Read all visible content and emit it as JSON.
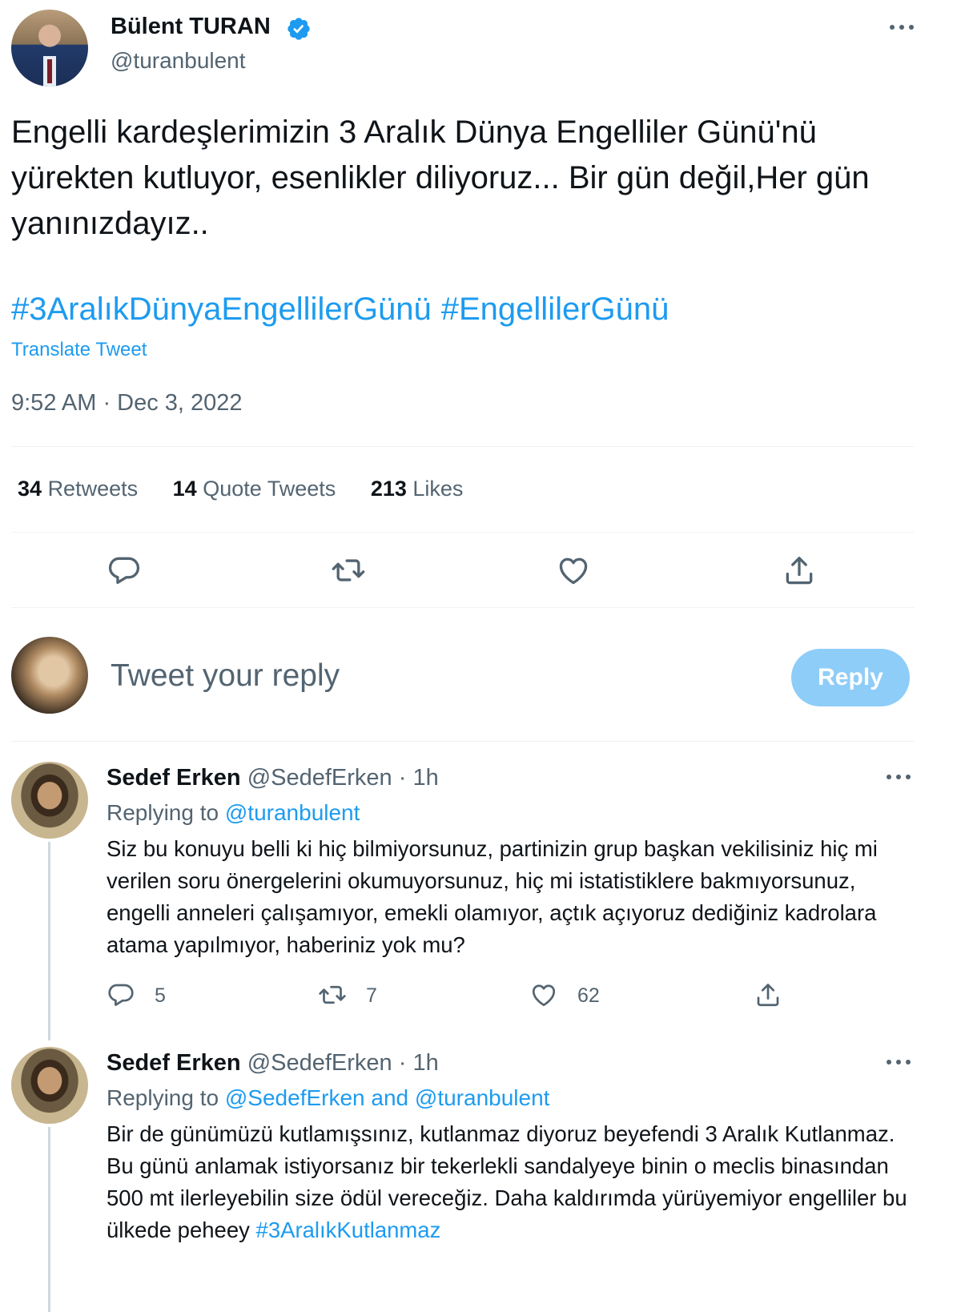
{
  "tweet": {
    "author_name": "Bülent TURAN",
    "author_handle": "@turanbulent",
    "text": "Engelli kardeşlerimizin 3 Aralık Dünya Engelliler Günü'nü yürekten kutluyor, esenlikler diliyoruz... Bir gün değil,Her gün yanınızdayız..",
    "hashtags": [
      "#3AralıkDünyaEngellilerGünü",
      "#EngellilerGünü"
    ],
    "translate_label": "Translate Tweet",
    "timestamp": "9:52 AM · Dec 3, 2022",
    "stats": {
      "retweets_count": "34",
      "retweets_label": "Retweets",
      "quotes_count": "14",
      "quotes_label": "Quote Tweets",
      "likes_count": "213",
      "likes_label": "Likes"
    }
  },
  "composer": {
    "placeholder": "Tweet your reply",
    "button_label": "Reply"
  },
  "replies": [
    {
      "name": "Sedef Erken",
      "handle": "@SedefErken",
      "time": "· 1h",
      "replying_prefix": "Replying to",
      "replying_mentions": "@turanbulent",
      "text": "Siz bu konuyu belli ki hiç bilmiyorsunuz, partinizin grup başkan vekilisiniz hiç mi verilen soru önergelerini okumuyorsunuz, hiç mi istatistiklere bakmıyorsunuz, engelli anneleri çalışamıyor, emekli olamıyor, açtık açıyoruz dediğiniz kadrolara atama yapılmıyor, haberiniz yok mu?",
      "reply_count": "5",
      "retweet_count": "7",
      "like_count": "62"
    },
    {
      "name": "Sedef Erken",
      "handle": "@SedefErken",
      "time": "· 1h",
      "replying_prefix": "Replying to",
      "replying_mentions": "@SedefErken and @turanbulent",
      "text": "Bir de günümüzü kutlamışsınız, kutlanmaz diyoruz beyefendi 3 Aralık Kutlanmaz. Bu günü anlamak istiyorsanız bir tekerlekli sandalyeye binin o meclis binasından 500 mt ilerleyebilin size ödül vereceğiz. Daha kaldırımda yürüyemiyor engelliler bu ülkede peheey",
      "hashtag": "#3AralıkKutlanmaz"
    }
  ],
  "colors": {
    "accent": "#1d9bf0",
    "muted": "#536471",
    "reply_button": "#8ecdf8"
  },
  "icons": [
    "verified-icon",
    "more-icon",
    "reply-icon",
    "retweet-icon",
    "like-icon",
    "share-icon"
  ]
}
